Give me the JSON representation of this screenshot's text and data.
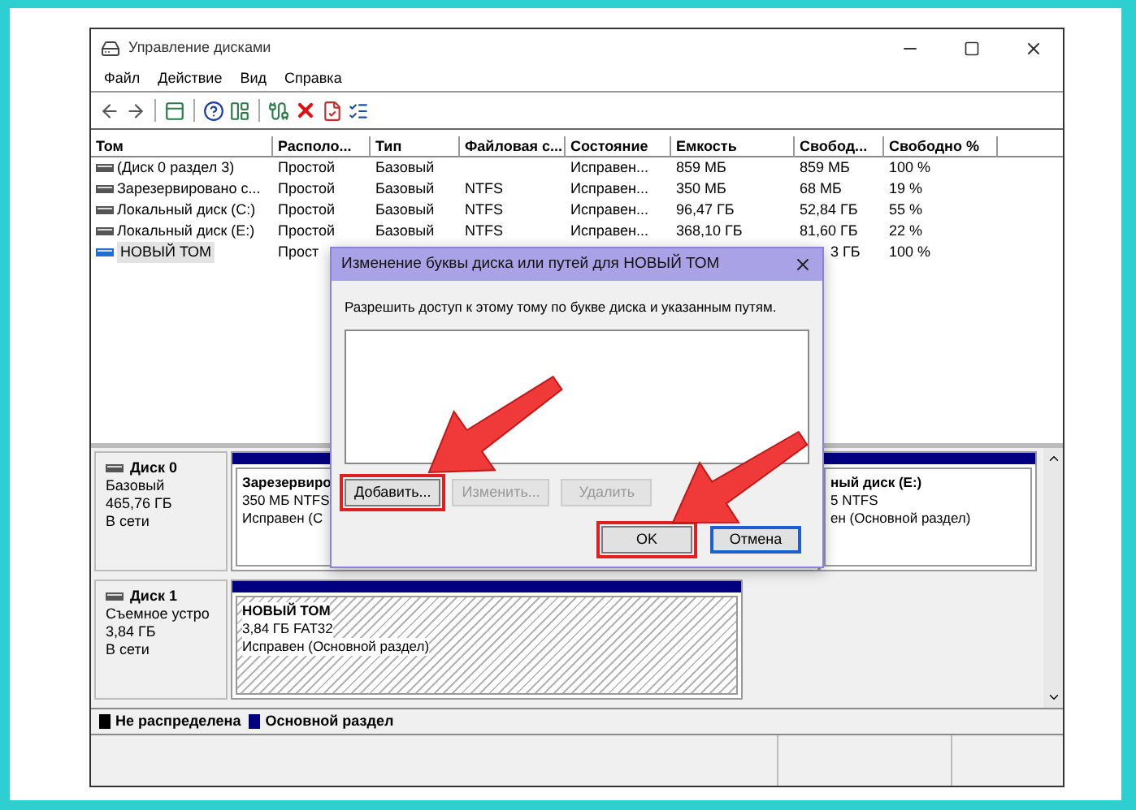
{
  "window": {
    "title": "Управление дисками"
  },
  "menu": [
    "Файл",
    "Действие",
    "Вид",
    "Справка"
  ],
  "table": {
    "columns": [
      "Том",
      "Располо...",
      "Тип",
      "Файловая с...",
      "Состояние",
      "Емкость",
      "Свобод...",
      "Свободно %"
    ],
    "rows": [
      {
        "kind": "fixed",
        "selected": false,
        "volume": "(Диск 0 раздел 3)",
        "layout": "Простой",
        "type": "Базовый",
        "status": "Исправен...",
        "capacity": "859 МБ",
        "free": "859 МБ",
        "free_percent": "100 %"
      },
      {
        "kind": "fixed",
        "selected": false,
        "volume": "Зарезервировано с...",
        "layout": "Простой",
        "type": "Базовый",
        "file_system": "NTFS",
        "status": "Исправен...",
        "capacity": "350 МБ",
        "free": "68 МБ",
        "free_percent": "19 %"
      },
      {
        "kind": "fixed",
        "selected": false,
        "volume": "Локальный диск (C:)",
        "layout": "Простой",
        "type": "Базовый",
        "file_system": "NTFS",
        "status": "Исправен...",
        "capacity": "96,47 ГБ",
        "free": "52,84 ГБ",
        "free_percent": "55 %"
      },
      {
        "kind": "fixed",
        "selected": false,
        "volume": "Локальный диск (E:)",
        "layout": "Простой",
        "type": "Базовый",
        "file_system": "NTFS",
        "status": "Исправен...",
        "capacity": "368,10 ГБ",
        "free": "81,60 ГБ",
        "free_percent": "22 %"
      },
      {
        "kind": "removable",
        "selected": true,
        "volume": "НОВЫЙ ТОМ",
        "layout": "Прост",
        "free": "3 ГБ",
        "free_percent": "100 %"
      }
    ]
  },
  "disks": [
    {
      "name": "Диск 0",
      "info": [
        "Базовый",
        "465,76 ГБ",
        "В сети"
      ],
      "partitions": [
        {
          "selected": false,
          "lines": [
            "Зарезервиро",
            "350 МБ NTFS",
            "Исправен (С"
          ]
        },
        {
          "selected": false,
          "lines": [
            "ный диск  (E:)",
            "5 NTFS",
            "ен (Основной раздел)"
          ]
        }
      ]
    },
    {
      "name": "Диск 1",
      "info": [
        "Съемное устро",
        "3,84 ГБ",
        "В сети"
      ],
      "partitions": [
        {
          "selected": true,
          "lines": [
            "НОВЫЙ ТОМ",
            "3,84 ГБ FAT32",
            "Исправен (Основной раздел)"
          ]
        }
      ]
    }
  ],
  "legend": [
    {
      "label": "Не распределена",
      "color": "#000000"
    },
    {
      "label": "Основной раздел",
      "color": "#000080"
    }
  ],
  "dialog": {
    "title": "Изменение буквы диска или путей для НОВЫЙ ТОМ",
    "prompt": "Разрешить доступ к этому тому по букве диска и указанным путям.",
    "buttons": [
      {
        "label": "Добавить...",
        "disabled": false,
        "highlighted": true
      },
      {
        "label": "Изменить...",
        "disabled": true,
        "highlighted": false
      },
      {
        "label": "Удалить",
        "disabled": true,
        "highlighted": false
      }
    ],
    "footer_buttons": [
      {
        "label": "OK",
        "highlighted": true,
        "focused": false
      },
      {
        "label": "Отмена",
        "highlighted": false,
        "focused": true
      }
    ]
  }
}
